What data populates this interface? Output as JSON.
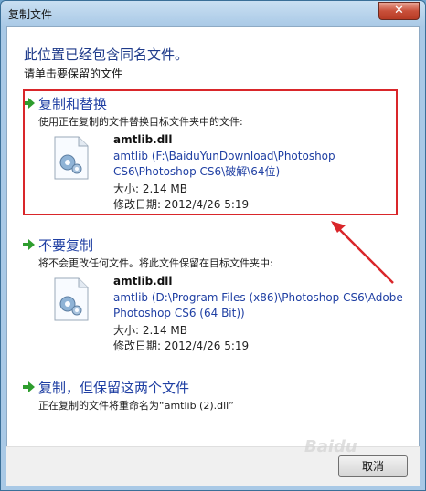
{
  "window": {
    "title": "复制文件",
    "close_label": "✕"
  },
  "header": {
    "heading": "此位置已经包含同名文件。",
    "subheading": "请单击要保留的文件"
  },
  "options": [
    {
      "title": "复制和替换",
      "description": "使用正在复制的文件替换目标文件夹中的文件:",
      "file": {
        "name": "amtlib.dll",
        "path_line1": "amtlib (F:\\BaiduYunDownload\\Photoshop",
        "path_line2": "CS6\\Photoshop CS6\\破解\\64位)",
        "size": "大小: 2.14 MB",
        "date": "修改日期: 2012/4/26 5:19"
      }
    },
    {
      "title": "不要复制",
      "description": "将不会更改任何文件。将此文件保留在目标文件夹中:",
      "file": {
        "name": "amtlib.dll",
        "path_line1": "amtlib (D:\\Program Files (x86)\\Photoshop CS6\\Adobe",
        "path_line2": "Photoshop CS6 (64 Bit))",
        "size": "大小: 2.14 MB",
        "date": "修改日期: 2012/4/26 5:19"
      }
    },
    {
      "title": "复制，但保留这两个文件",
      "description": "正在复制的文件将重命名为“amtlib (2).dll”"
    }
  ],
  "footer": {
    "cancel_label": "取消"
  },
  "icons": {
    "arrow": "green-arrow-icon",
    "file": "dll-file-icon"
  },
  "colors": {
    "accent": "#1f3fa3",
    "highlight": "#d9262a",
    "arrow_green": "#2e9d2e"
  },
  "watermark": "Baidu"
}
